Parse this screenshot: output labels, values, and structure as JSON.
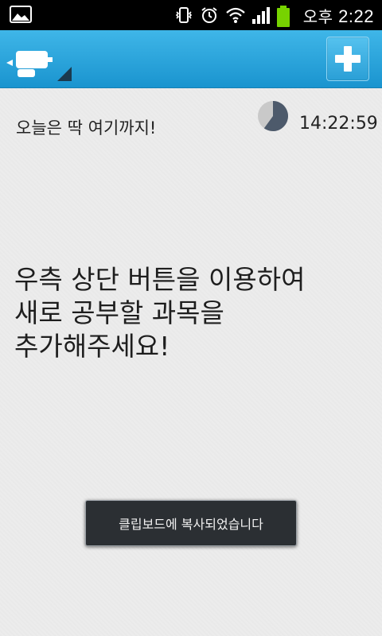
{
  "status_bar": {
    "ampm": "오후",
    "time": "2:22",
    "icons": [
      "picture-icon",
      "vibrate-icon",
      "alarm-icon",
      "wifi-icon",
      "signal-icon",
      "battery-icon"
    ]
  },
  "action_bar": {
    "app_icon": "app-logo-icon",
    "add_icon": "plus-icon"
  },
  "content": {
    "today_label": "오늘은 딱 여기까지!",
    "timer_time": "14:22:59",
    "timer_progress": 0.6,
    "empty_message": "우측 상단 버튼을 이용하여\n새로 공부할 과목을\n추가해주세요!"
  },
  "toast": {
    "message": "클립보드에 복사되었습니다"
  },
  "colors": {
    "action_bar": "#1a94cf",
    "battery": "#77d300",
    "pie_fill": "#4d5a6b",
    "pie_bg": "#c9c9c9"
  }
}
